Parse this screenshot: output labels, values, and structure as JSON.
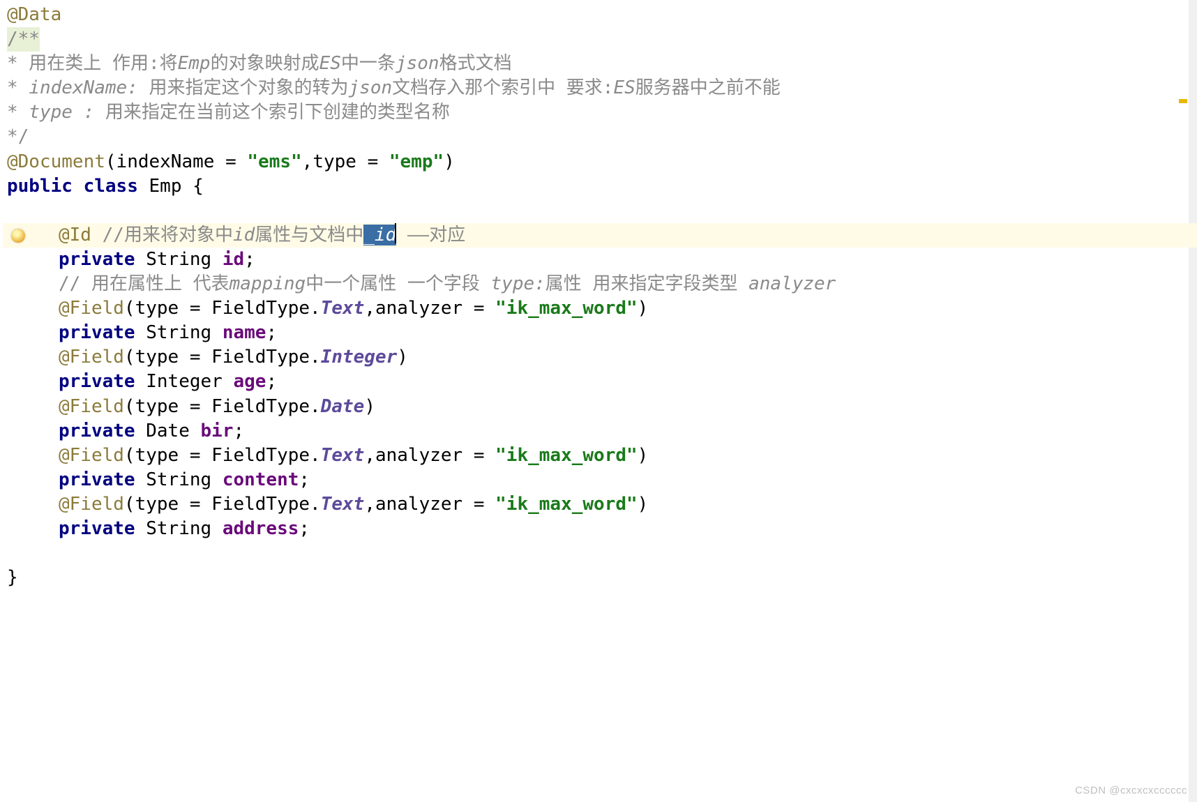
{
  "code": {
    "ann_data": "@Data",
    "doc_open": "/**",
    "doc_line1_prefix": " * 用在类上 作用:将",
    "doc_line1_emp": "Emp",
    "doc_line1_mid1": "的对象映射成",
    "doc_line1_es": "ES",
    "doc_line1_mid2": "中一条",
    "doc_line1_json": "json",
    "doc_line1_suffix": "格式文档",
    "doc_line2_prefix": " *        ",
    "doc_line2_key": "indexName:",
    "doc_line2_mid1": " 用来指定这个对象的转为",
    "doc_line2_json": "json",
    "doc_line2_mid2": "文档存入那个索引中  要求:",
    "doc_line2_es": "ES",
    "doc_line2_suffix": "服务器中之前不能",
    "doc_line3_prefix": " *        ",
    "doc_line3_key": "type       :",
    "doc_line3_text": " 用来指定在当前这个索引下创建的类型名称",
    "doc_close": " */",
    "ann_document": "@Document",
    "doc_args_open": "(indexName = ",
    "doc_args_str1": "\"ems\"",
    "doc_args_mid": ",type = ",
    "doc_args_str2": "\"emp\"",
    "doc_args_close": ")",
    "kw_public": "public",
    "kw_class": "class",
    "class_name": "Emp",
    "brace_open": "{",
    "ann_id": "@Id",
    "id_comment_slash": "//",
    "id_comment_p1": "用来将对象中",
    "id_comment_id_it": "id",
    "id_comment_p2": "属性与文档中",
    "id_comment_sel": "_id",
    "id_comment_p3": " ——对应",
    "kw_private": "private",
    "type_string": "String",
    "type_integer_obj": "Integer",
    "type_date": "Date",
    "field_id": "id",
    "field_name_comment_slash": "//",
    "field_name_comment_p1": " 用在属性上 代表",
    "field_name_comment_map": "mapping",
    "field_name_comment_p2": "中一个属性 一个字段 ",
    "field_name_comment_type": "type:",
    "field_name_comment_p3": "属性 用来指定字段类型 ",
    "field_name_comment_an": "analyzer",
    "ann_field": "@Field",
    "field_args_open": "(type = FieldType.",
    "ft_text": "Text",
    "ft_integer": "Integer",
    "ft_date": "Date",
    "field_args_analyzer": ",analyzer = ",
    "str_ik": "\"ik_max_word\"",
    "close_paren": ")",
    "field_name": "name",
    "field_age": "age",
    "field_bir": "bir",
    "field_content": "content",
    "field_address": "address",
    "semicolon": ";",
    "brace_close": "}"
  },
  "watermark": "CSDN @cxcxcxcccccc"
}
